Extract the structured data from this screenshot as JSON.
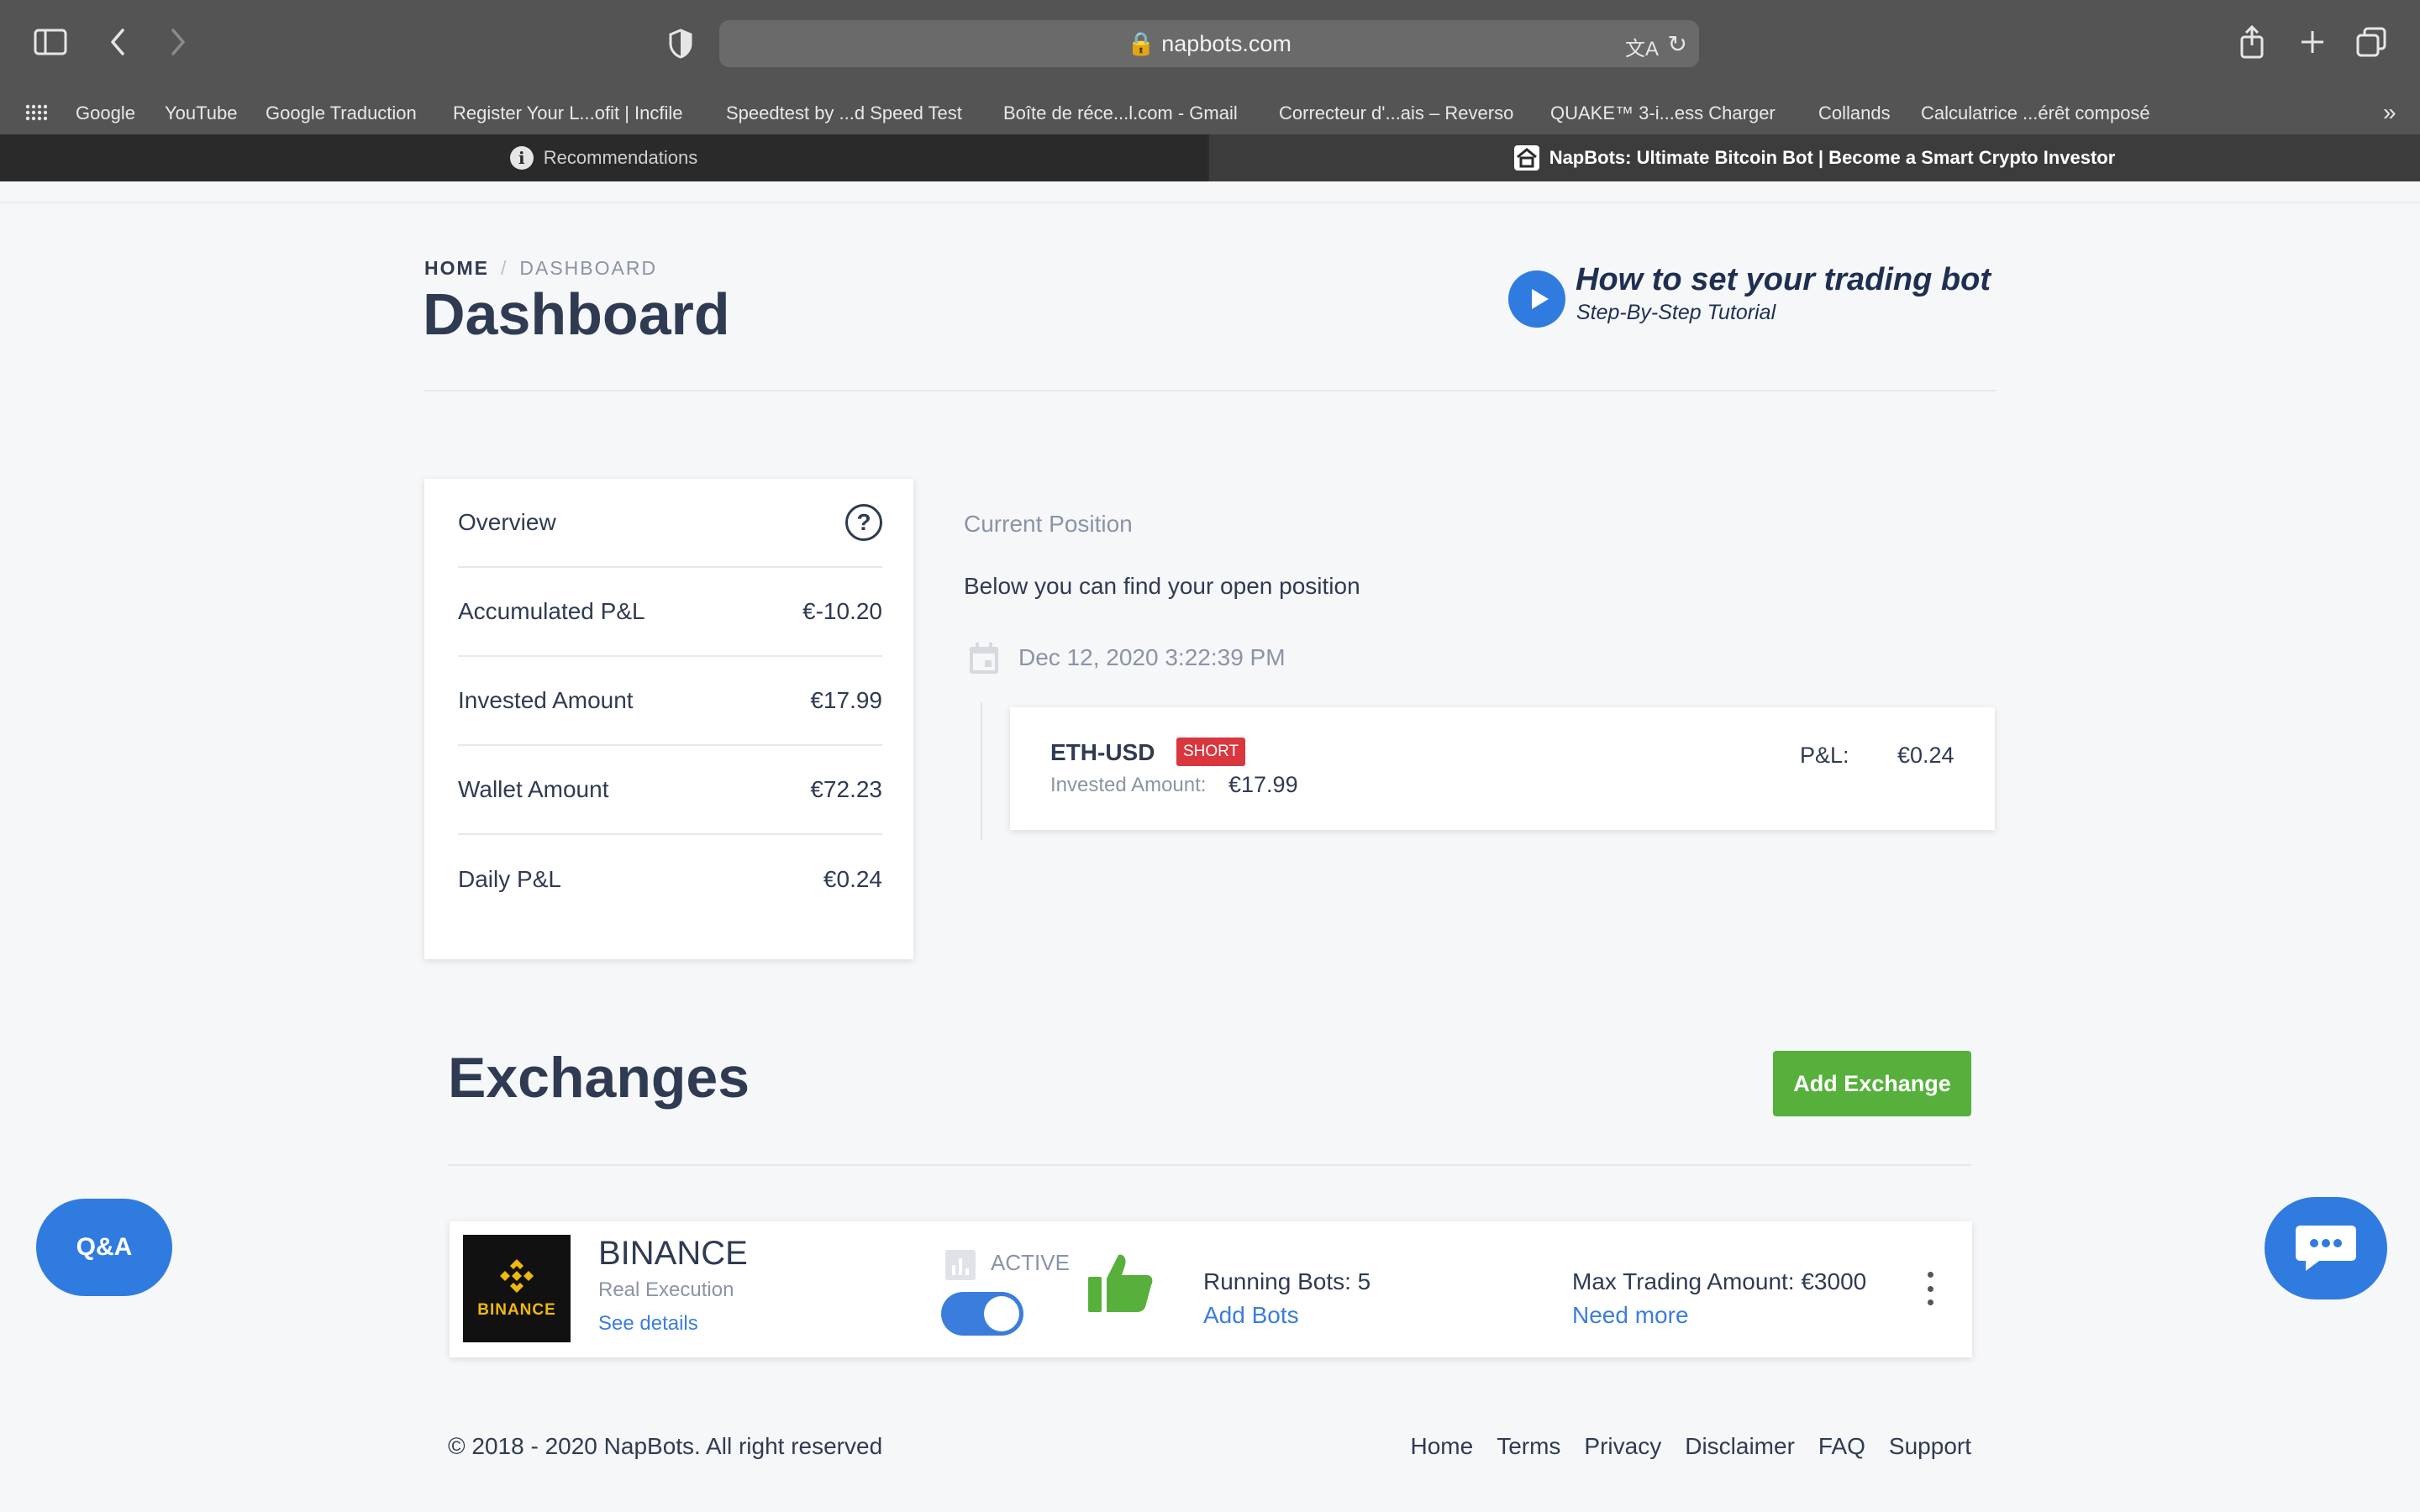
{
  "browser": {
    "url": "napbots.com",
    "bookmarks": [
      "Google",
      "YouTube",
      "Google Traduction",
      "Register Your L...ofit | Incfile",
      "Speedtest by ...d Speed Test",
      "Boîte de réce...l.com - Gmail",
      "Correcteur d'...ais – Reverso",
      "QUAKE™ 3-i...ess Charger",
      "Collands",
      "Calculatrice ...érêt composé"
    ],
    "tabs": [
      {
        "label": "Recommendations",
        "active": false
      },
      {
        "label": "NapBots: Ultimate Bitcoin Bot | Become a Smart Crypto Investor",
        "active": true
      }
    ]
  },
  "breadcrumb": {
    "home": "HOME",
    "separator": "/",
    "current": "DASHBOARD"
  },
  "page_title": "Dashboard",
  "tutorial": {
    "title": "How to set your trading bot",
    "subtitle": "Step-By-Step Tutorial"
  },
  "overview": {
    "title": "Overview",
    "rows": [
      {
        "label": "Accumulated P&L",
        "value": "€-10.20"
      },
      {
        "label": "Invested Amount",
        "value": "€17.99"
      },
      {
        "label": "Wallet Amount",
        "value": "€72.23"
      },
      {
        "label": "Daily P&L",
        "value": "€0.24"
      }
    ]
  },
  "current_position": {
    "label": "Current Position",
    "description": "Below you can find your open position",
    "date": "Dec 12, 2020 3:22:39 PM",
    "position": {
      "symbol": "ETH-USD",
      "side": "SHORT",
      "invested_label": "Invested Amount:",
      "invested_value": "€17.99",
      "pl_label": "P&L:",
      "pl_value": "€0.24"
    }
  },
  "exchanges": {
    "title": "Exchanges",
    "add_button": "Add Exchange",
    "items": [
      {
        "logo_text": "BINANCE",
        "name": "BINANCE",
        "mode": "Real Execution",
        "details_link": "See details",
        "status": "ACTIVE",
        "toggle_on": true,
        "running_bots": "Running Bots: 5",
        "add_bots": "Add Bots",
        "max_trading": "Max Trading Amount: €3000",
        "need_more": "Need more"
      }
    ]
  },
  "footer": {
    "copyright": "© 2018 - 2020 NapBots. All right reserved",
    "links": [
      "Home",
      "Terms",
      "Privacy",
      "Disclaimer",
      "FAQ",
      "Support"
    ]
  },
  "floating": {
    "qa_label": "Q&A"
  },
  "colors": {
    "accent_blue": "#2f7be0",
    "success_green": "#57b03c",
    "short_red": "#d9363e",
    "binance_gold": "#f0b90b"
  }
}
